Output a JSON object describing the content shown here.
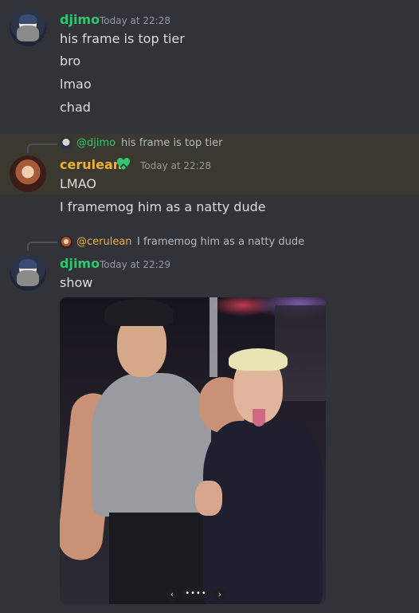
{
  "messages": [
    {
      "author": "djimo",
      "timestamp": "Today at 22:28",
      "lines": [
        "his frame is top tier",
        "bro",
        "lmao",
        "chad"
      ]
    },
    {
      "reply_to": {
        "mention": "@djimo",
        "text": "his frame is top tier"
      },
      "author": "cerulean",
      "timestamp": "Today at 22:28",
      "badge_icon": "heart-leaf-badge-icon",
      "lines": [
        "LMAO",
        "I framemog him as a natty dude"
      ]
    },
    {
      "reply_to": {
        "mention": "@cerulean",
        "text": "I framemog him as a natty dude"
      },
      "author": "djimo",
      "timestamp": "Today at 22:29",
      "lines": [
        "show"
      ],
      "attachment": {
        "type": "image",
        "icon": "photo-attachment"
      }
    }
  ],
  "carousel": {
    "prev_icon": "‹",
    "next_icon": "›",
    "dots": "••••"
  },
  "colors": {
    "background": "#313338",
    "highlight": "#3a382f",
    "djimo_name": "#2dc770",
    "cerulean_name": "#f0b132",
    "text": "#dbdee1",
    "timestamp": "#949ba4"
  }
}
